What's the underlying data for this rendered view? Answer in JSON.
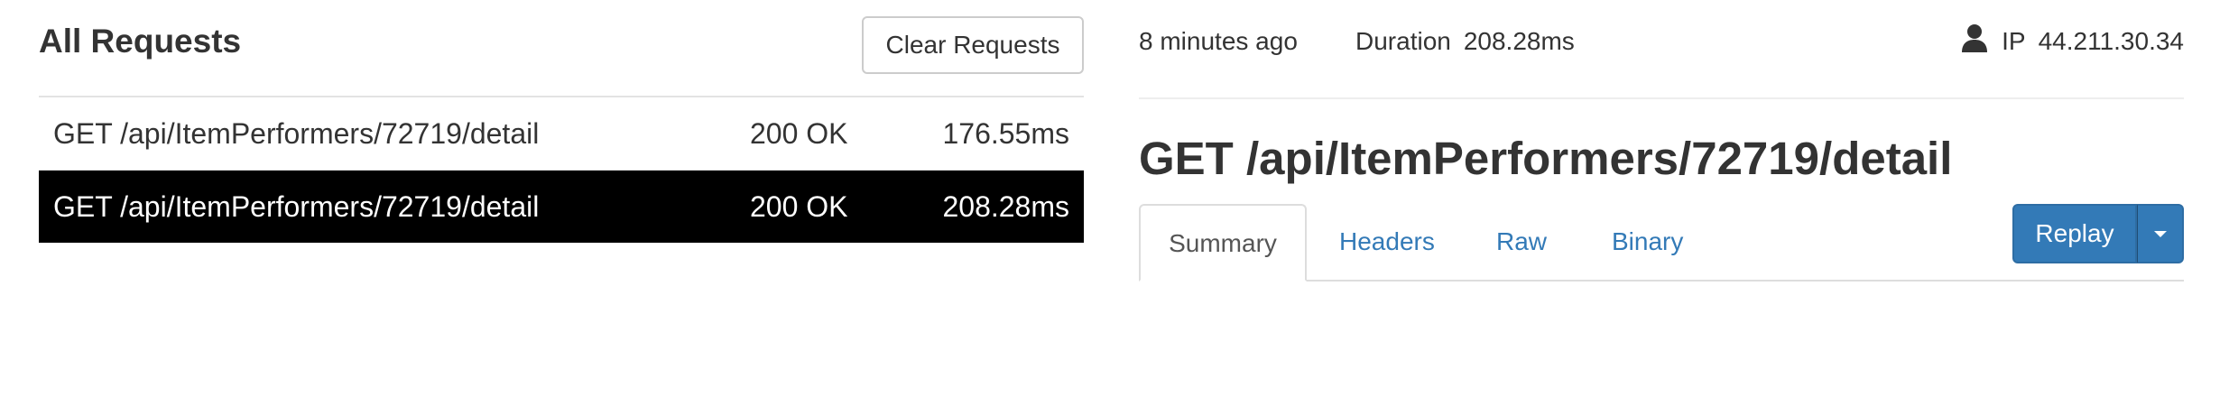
{
  "requests_panel": {
    "title": "All Requests",
    "clear_label": "Clear Requests",
    "rows": [
      {
        "method_path": "GET /api/ItemPerformers/72719/detail",
        "status": "200 OK",
        "duration": "176.55ms",
        "selected": false
      },
      {
        "method_path": "GET /api/ItemPerformers/72719/detail",
        "status": "200 OK",
        "duration": "208.28ms",
        "selected": true
      }
    ]
  },
  "detail": {
    "time_ago": "8 minutes ago",
    "duration_label": "Duration",
    "duration_value": "208.28ms",
    "user_icon": "user-icon",
    "ip_label": "IP",
    "ip_value": "44.211.30.34",
    "title": "GET /api/ItemPerformers/72719/detail",
    "tabs": [
      {
        "label": "Summary",
        "active": true
      },
      {
        "label": "Headers",
        "active": false
      },
      {
        "label": "Raw",
        "active": false
      },
      {
        "label": "Binary",
        "active": false
      }
    ],
    "replay_label": "Replay",
    "replay_menu_icon": "caret-down-icon"
  },
  "colors": {
    "accent": "#337ab7",
    "selected_row_bg": "#000000",
    "selected_row_text": "#ffffff",
    "text": "#333333"
  }
}
